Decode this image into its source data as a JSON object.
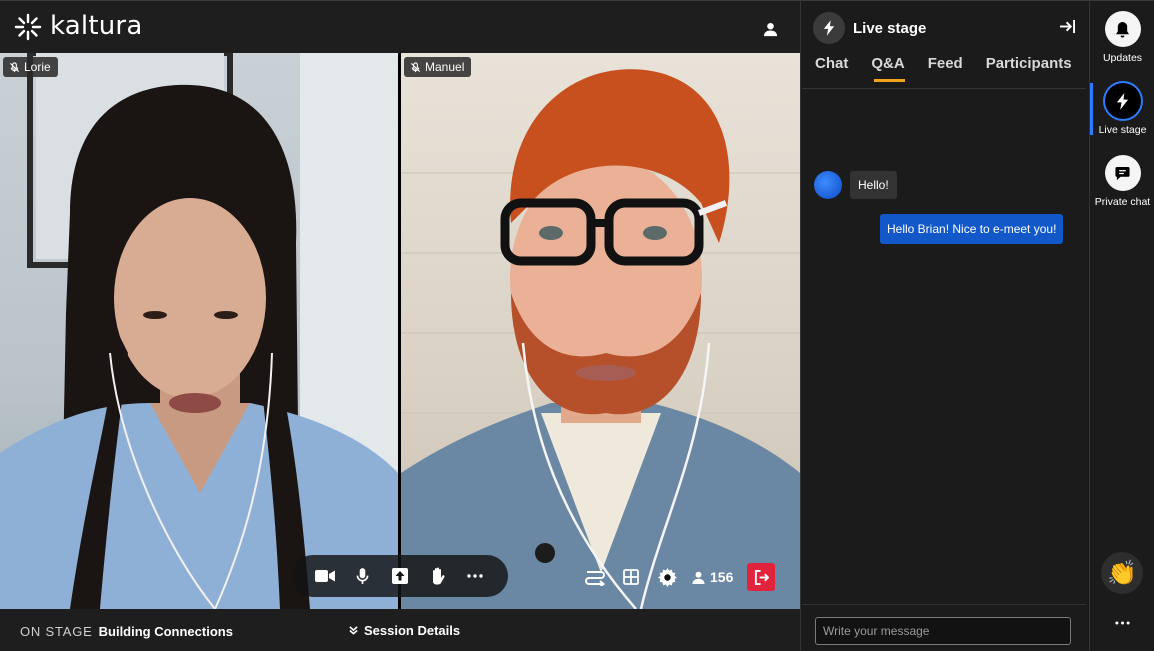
{
  "app": {
    "brand": "kaltura",
    "accent_color": "#f1a31b",
    "leave_color": "#e2233c",
    "blue_color": "#1258c9"
  },
  "stage": {
    "participants": [
      {
        "name": "Lorie",
        "muted": true
      },
      {
        "name": "Manuel",
        "muted": true
      }
    ],
    "controls": {
      "icons": [
        "camera-icon",
        "microphone-icon",
        "share-screen-icon",
        "raise-hand-icon",
        "more-icon"
      ]
    },
    "right_controls": {
      "icons": [
        "switch-layout-icon",
        "grid-icon",
        "settings-icon",
        "person-icon",
        "leave-icon"
      ],
      "attendee_count": "156"
    }
  },
  "bottom": {
    "on_stage_label": "ON STAGE",
    "session_title": "Building Connections",
    "session_details": "Session Details"
  },
  "panel": {
    "title": "Live stage",
    "tabs": [
      {
        "label": "Chat",
        "active": false
      },
      {
        "label": "Q&A",
        "active": true
      },
      {
        "label": "Feed",
        "active": false
      },
      {
        "label": "Participants",
        "active": false
      }
    ],
    "messages": [
      {
        "text": "Hello!",
        "direction": "incoming"
      },
      {
        "text": "Hello Brian! Nice to e-meet you!",
        "direction": "outgoing"
      }
    ],
    "input_placeholder": "Write your message"
  },
  "rail": {
    "items": [
      {
        "label": "Updates",
        "icon": "bell-icon"
      },
      {
        "label": "Live stage",
        "icon": "bolt-icon",
        "active": true
      },
      {
        "label": "Private chat",
        "icon": "chat-icon"
      }
    ],
    "reaction_emoji": "👏"
  }
}
